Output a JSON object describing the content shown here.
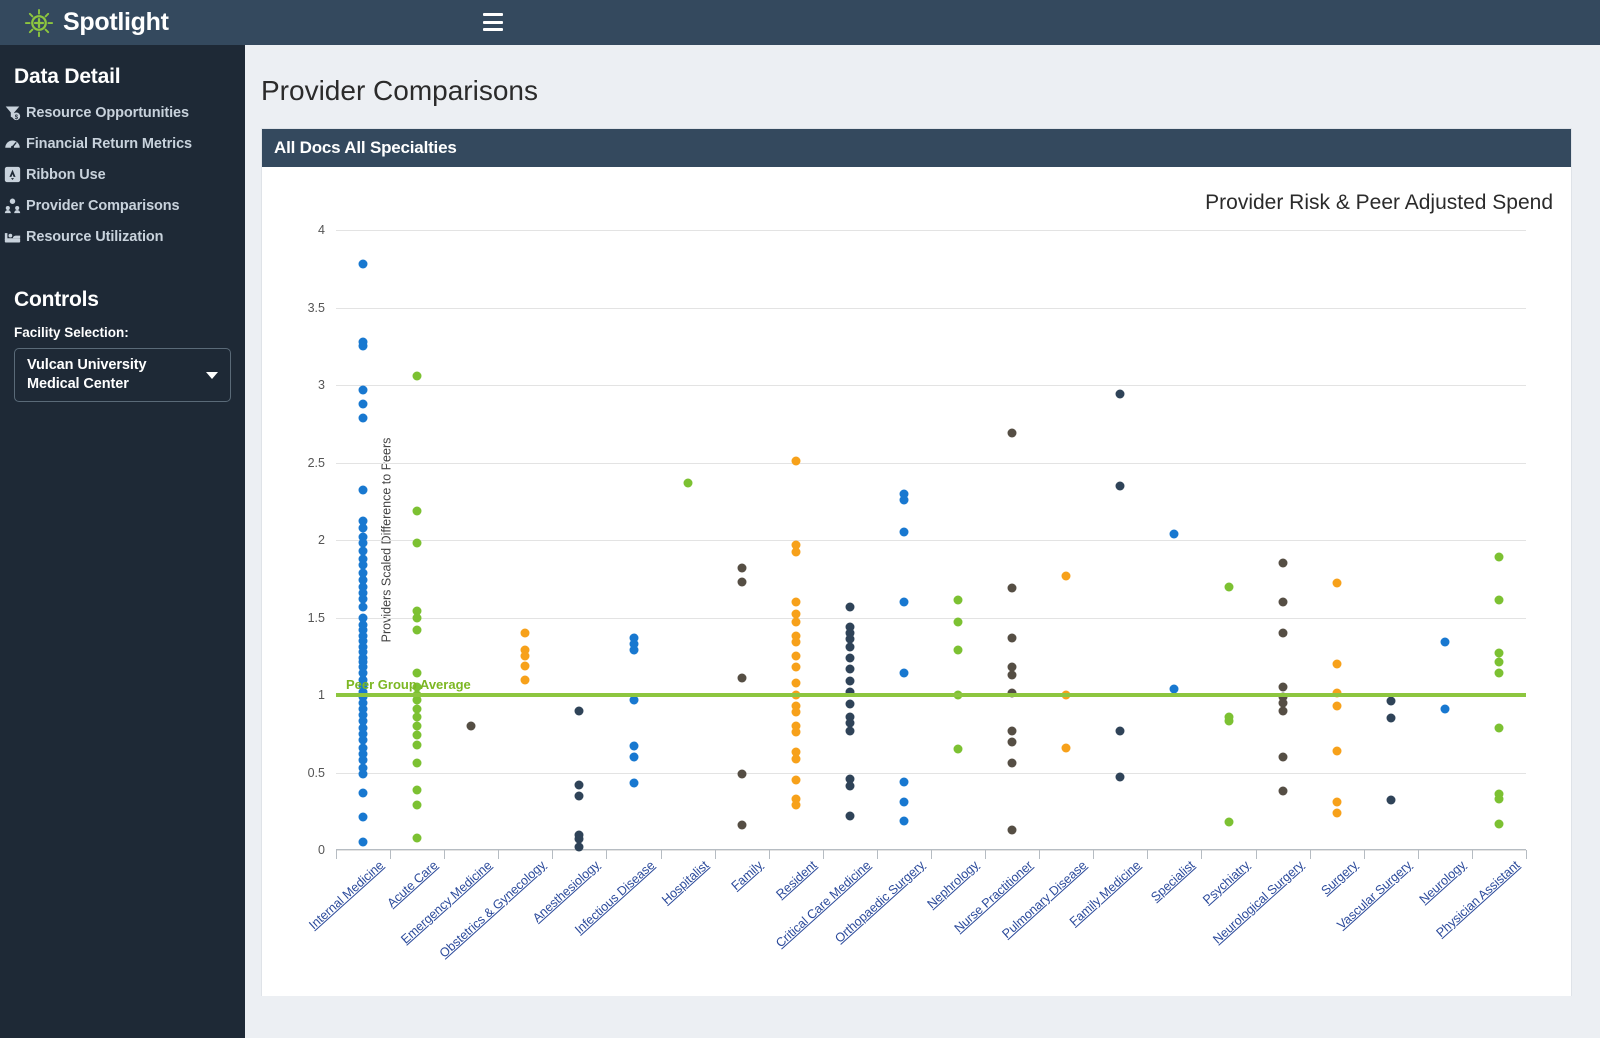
{
  "brand": {
    "name": "Spotlight",
    "logo_icon": "sun-plus-icon"
  },
  "topbar": {
    "menu_icon": "hamburger-icon"
  },
  "sidebar": {
    "section_title": "Data Detail",
    "items": [
      {
        "label": "Resource Opportunities",
        "icon": "funnel-dollar-icon"
      },
      {
        "label": "Financial Return Metrics",
        "icon": "gauge-icon"
      },
      {
        "label": "Ribbon Use",
        "icon": "ribbon-icon"
      },
      {
        "label": "Provider Comparisons",
        "icon": "people-icon"
      },
      {
        "label": "Resource Utilization",
        "icon": "bed-icon"
      }
    ],
    "controls_title": "Controls",
    "facility_label": "Facility Selection:",
    "facility_value": "Vulcan University Medical Center",
    "caret_icon": "chevron-down-icon"
  },
  "page": {
    "title": "Provider Comparisons",
    "panel_title": "All Docs All Specialties"
  },
  "colors": {
    "accent_green": "#8dc63f",
    "header_navy": "#34495e",
    "sidebar_navy": "#1e2936",
    "blue": "#1878d0",
    "green": "#7cc132",
    "orange": "#f7a11a",
    "slate": "#2f4358",
    "brown": "#554e44"
  },
  "chart_data": {
    "type": "scatter",
    "title": "Provider Risk & Peer Adjusted Spend",
    "xlabel": "",
    "ylabel": "Providers Scaled Difference to Peers",
    "ylim": [
      0,
      4
    ],
    "yticks": [
      0,
      0.5,
      1,
      1.5,
      2,
      2.5,
      3,
      3.5,
      4
    ],
    "grid": true,
    "legend": "none",
    "reference_line": {
      "value": 1,
      "label": "Peer Group Average",
      "color": "#8dc63f"
    },
    "categories": [
      "Internal Medicine",
      "Acute Care",
      "Emergency Medicine",
      "Obstetrics & Gynecology",
      "Anesthesiology",
      "Infectious Disease",
      "Hospitalist",
      "Family",
      "Resident",
      "Critical Care Medicine",
      "Orthopaedic Surgery",
      "Nephrology",
      "Nurse Practitioner",
      "Pulmonary Disease",
      "Family Medicine",
      "Specialist",
      "Psychiatry",
      "Neurological Surgery",
      "Surgery",
      "Vascular Surgery",
      "Neurology",
      "Physician Assistant"
    ],
    "series": [
      {
        "name": "Internal Medicine",
        "color": "#1878d0",
        "values": [
          3.78,
          3.28,
          3.25,
          2.97,
          2.88,
          2.79,
          2.32,
          2.12,
          2.08,
          2.02,
          1.98,
          1.93,
          1.88,
          1.84,
          1.79,
          1.74,
          1.7,
          1.66,
          1.62,
          1.57,
          1.5,
          1.45,
          1.42,
          1.38,
          1.35,
          1.31,
          1.28,
          1.24,
          1.21,
          1.18,
          1.14,
          1.1,
          1.06,
          1.02,
          0.99,
          0.95,
          0.91,
          0.87,
          0.83,
          0.79,
          0.75,
          0.71,
          0.66,
          0.62,
          0.58,
          0.53,
          0.49,
          0.37,
          0.21,
          0.05
        ]
      },
      {
        "name": "Acute Care",
        "color": "#7cc132",
        "values": [
          3.06,
          2.19,
          1.98,
          1.54,
          1.5,
          1.42,
          1.14,
          1.05,
          1.0,
          0.97,
          0.91,
          0.86,
          0.8,
          0.74,
          0.68,
          0.56,
          0.39,
          0.29,
          0.08
        ]
      },
      {
        "name": "Emergency Medicine",
        "color": "#554e44",
        "values": [
          0.8
        ]
      },
      {
        "name": "Obstetrics & Gynecology",
        "color": "#f7a11a",
        "values": [
          1.4,
          1.29,
          1.25,
          1.19,
          1.1
        ]
      },
      {
        "name": "Anesthesiology",
        "color": "#2f4358",
        "values": [
          0.9,
          0.42,
          0.35,
          0.1,
          0.07,
          0.02
        ]
      },
      {
        "name": "Infectious Disease",
        "color": "#1878d0",
        "values": [
          1.37,
          1.33,
          1.29,
          0.97,
          0.67,
          0.6,
          0.43
        ]
      },
      {
        "name": "Hospitalist",
        "color": "#7cc132",
        "values": [
          2.37
        ]
      },
      {
        "name": "Family",
        "color": "#554e44",
        "values": [
          1.82,
          1.73,
          1.11,
          0.49,
          0.16
        ]
      },
      {
        "name": "Resident",
        "color": "#f7a11a",
        "values": [
          2.51,
          1.97,
          1.92,
          1.6,
          1.52,
          1.47,
          1.38,
          1.34,
          1.25,
          1.18,
          1.08,
          1.0,
          0.93,
          0.89,
          0.8,
          0.76,
          0.63,
          0.59,
          0.45,
          0.33,
          0.29
        ]
      },
      {
        "name": "Critical Care Medicine",
        "color": "#2f4358",
        "values": [
          1.57,
          1.44,
          1.4,
          1.36,
          1.31,
          1.24,
          1.17,
          1.09,
          1.02,
          0.94,
          0.86,
          0.82,
          0.77,
          0.46,
          0.41,
          0.22
        ]
      },
      {
        "name": "Orthopaedic Surgery",
        "color": "#1878d0",
        "values": [
          2.3,
          2.26,
          2.05,
          1.6,
          1.14,
          0.44,
          0.31,
          0.19
        ]
      },
      {
        "name": "Nephrology",
        "color": "#7cc132",
        "values": [
          1.61,
          1.47,
          1.29,
          1.0,
          0.65
        ]
      },
      {
        "name": "Nurse Practitioner",
        "color": "#554e44",
        "values": [
          2.69,
          1.69,
          1.37,
          1.18,
          1.13,
          1.01,
          0.77,
          0.7,
          0.56,
          0.13
        ]
      },
      {
        "name": "Pulmonary Disease",
        "color": "#f7a11a",
        "values": [
          1.77,
          1.0,
          0.66
        ]
      },
      {
        "name": "Family Medicine",
        "color": "#2f4358",
        "values": [
          2.94,
          2.35,
          0.77,
          0.47
        ]
      },
      {
        "name": "Specialist",
        "color": "#1878d0",
        "values": [
          2.04,
          1.04
        ]
      },
      {
        "name": "Psychiatry",
        "color": "#7cc132",
        "values": [
          1.7,
          0.86,
          0.83,
          0.18
        ]
      },
      {
        "name": "Neurological Surgery",
        "color": "#554e44",
        "values": [
          1.85,
          1.6,
          1.4,
          1.05,
          0.99,
          0.95,
          0.9,
          0.6,
          0.38
        ]
      },
      {
        "name": "Surgery",
        "color": "#f7a11a",
        "values": [
          1.72,
          1.2,
          1.01,
          0.93,
          0.64,
          0.31,
          0.24
        ]
      },
      {
        "name": "Vascular Surgery",
        "color": "#2f4358",
        "values": [
          0.96,
          0.85,
          0.32
        ]
      },
      {
        "name": "Neurology",
        "color": "#1878d0",
        "values": [
          1.34,
          0.91
        ]
      },
      {
        "name": "Physician Assistant",
        "color": "#7cc132",
        "values": [
          1.89,
          1.61,
          1.27,
          1.21,
          1.14,
          0.79,
          0.36,
          0.33,
          0.17
        ]
      }
    ]
  }
}
